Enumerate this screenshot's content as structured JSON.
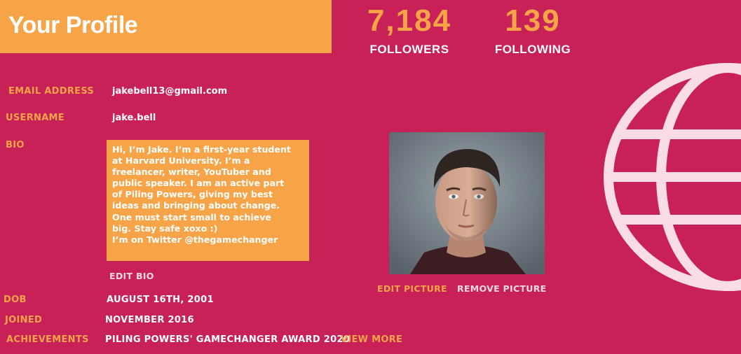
{
  "header": {
    "title": "Your Profile"
  },
  "stats": {
    "followers": {
      "value": "7,184",
      "label": "FOLLOWERS"
    },
    "following": {
      "value": "139",
      "label": "FOLLOWING"
    }
  },
  "profile": {
    "email_label": "EMAIL ADDRESS",
    "email_value": "jakebell13@gmail.com",
    "username_label": "USERNAME",
    "username_value": "jake.bell",
    "bio_label": "BIO",
    "bio_text": "Hi, I’m Jake. I’m a first-year student\nat Harvard University. I’m a\nfreelancer, writer, YouTuber and\npublic speaker. I am an active part\nof Piling Powers, giving my best\nideas and bringing about change.\nOne must start small to achieve\nbig. Stay safe xoxo :)\nI’m on Twitter @thegamechanger",
    "edit_bio": "EDIT BIO",
    "dob_label": "DOB",
    "dob_value": "AUGUST 16TH, 2001",
    "joined_label": "JOINED",
    "joined_value": "NOVEMBER 2016",
    "achievements_label": "ACHIEVEMENTS",
    "achievements_value": "PILING POWERS' GAMECHANGER AWARD 2020",
    "view_more": "VIEW MORE"
  },
  "picture": {
    "edit_label": "EDIT PICTURE",
    "remove_label": "REMOVE PICTURE"
  },
  "colors": {
    "background": "#c72158",
    "accent": "#f7a448",
    "text": "#ffffff",
    "globe": "#f9dce6"
  },
  "icons": {
    "decor": "globe-icon"
  }
}
